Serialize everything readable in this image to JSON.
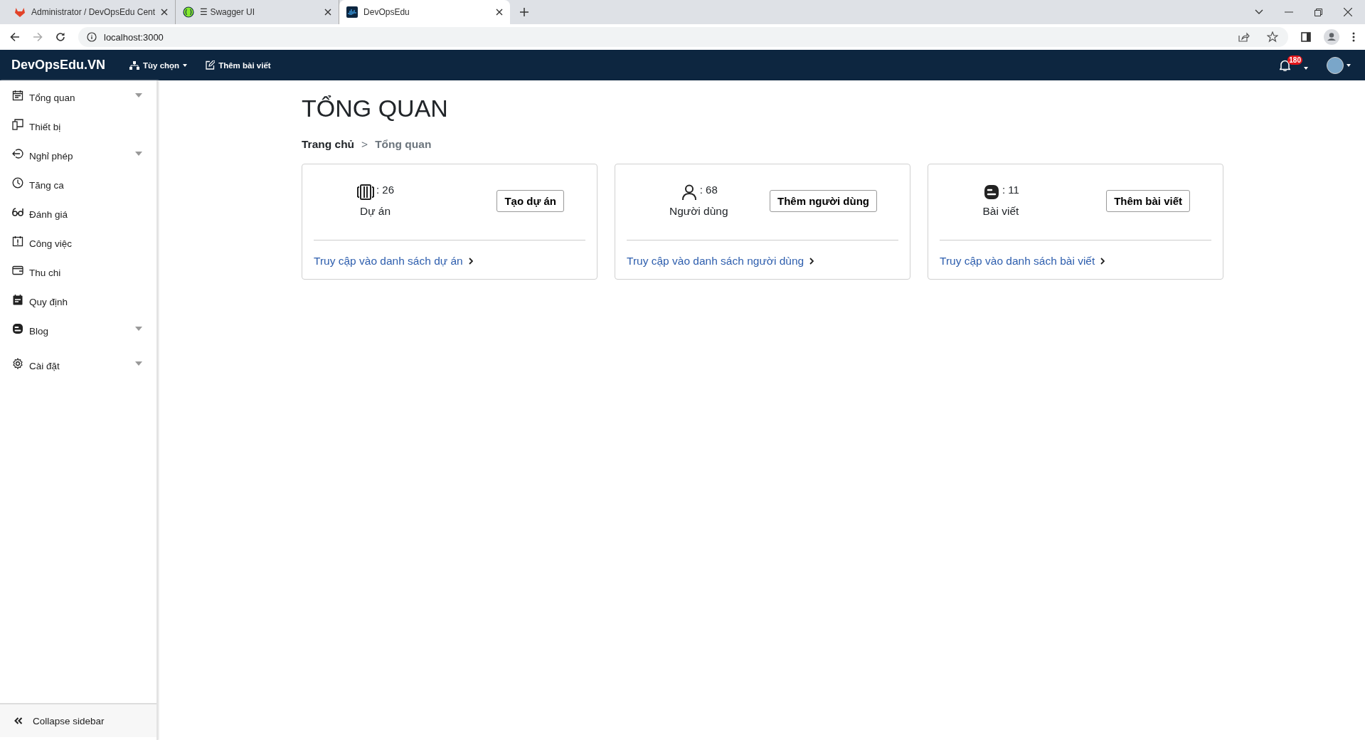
{
  "browser": {
    "tabs": [
      {
        "title": "Administrator / DevOpsEdu Cent",
        "selected": false
      },
      {
        "title": "☰ Swagger UI",
        "selected": false
      },
      {
        "title": "DevOpsEdu",
        "selected": true
      }
    ],
    "url": "localhost:3000"
  },
  "navbar": {
    "brand": "DevOpsEdu.VN",
    "menu": [
      {
        "label": "Tùy chọn",
        "dropdown": true
      },
      {
        "label": "Thêm bài viết",
        "dropdown": false
      }
    ],
    "notification_count": "180"
  },
  "sidebar": {
    "items": [
      {
        "label": "Tổng quan",
        "expandable": true
      },
      {
        "label": "Thiết bị",
        "expandable": false
      },
      {
        "label": "Nghỉ phép",
        "expandable": true
      },
      {
        "label": "Tăng ca",
        "expandable": false
      },
      {
        "label": "Đánh giá",
        "expandable": false
      },
      {
        "label": "Công việc",
        "expandable": false
      },
      {
        "label": "Thu chi",
        "expandable": false
      },
      {
        "label": "Quy định",
        "expandable": false
      },
      {
        "label": "Blog",
        "expandable": true
      },
      {
        "label": "Cài đặt",
        "expandable": true
      }
    ],
    "collapse": "Collapse sidebar"
  },
  "page": {
    "title": "TỔNG QUAN",
    "breadcrumb": [
      "Trang chủ",
      "Tổng quan"
    ],
    "breadcrumb_separator": ">"
  },
  "cards": [
    {
      "count": ": 26",
      "label": "Dự án",
      "button": "Tạo dự án",
      "link": "Truy cập vào danh sách dự án"
    },
    {
      "count": ": 68",
      "label": "Người dùng",
      "button": "Thêm người dùng",
      "link": "Truy cập vào danh sách người dùng"
    },
    {
      "count": ": 11",
      "label": "Bài viết",
      "button": "Thêm bài viết",
      "link": "Truy cập vào danh sách bài viết"
    }
  ]
}
